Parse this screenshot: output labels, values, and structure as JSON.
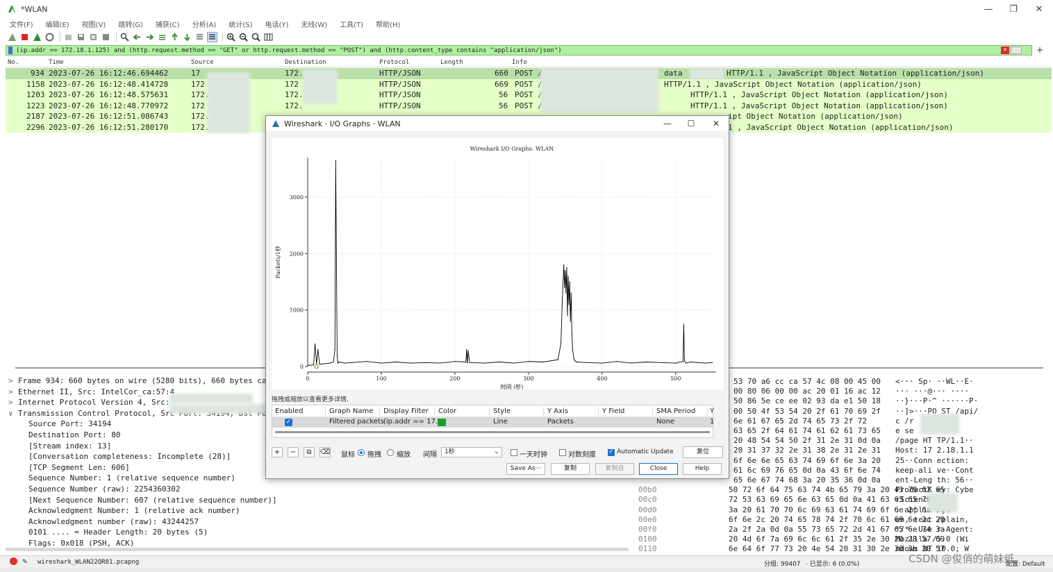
{
  "window": {
    "title": "*WLAN",
    "min": "—",
    "max": "❐",
    "close": "✕"
  },
  "menu": [
    "文件(F)",
    "编辑(E)",
    "视图(V)",
    "跳转(G)",
    "捕获(C)",
    "分析(A)",
    "统计(S)",
    "电话(Y)",
    "无线(W)",
    "工具(T)",
    "帮助(H)"
  ],
  "toolbar": [
    "shark-fin-start-icon",
    "stop-capture-icon",
    "restart-capture-icon",
    "capture-options-icon",
    "open-file-icon",
    "save-file-icon",
    "close-file-icon",
    "reload-file-icon",
    "find-packet-icon",
    "go-back-icon",
    "go-forward-icon",
    "go-to-packet-icon",
    "go-first-icon",
    "go-last-icon",
    "autoscroll-icon",
    "colorize-icon",
    "zoom-in-icon",
    "zoom-out-icon",
    "normal-size-icon",
    "resize-columns-icon"
  ],
  "filter": {
    "text": "(ip.addr == 172.18.1.125) and (http.request.method == \"GET\" or http.request.method == \"POST\") and (http.content_type contains \"application/json\")",
    "clear": "✕",
    "add": "+"
  },
  "packet_list": {
    "columns": [
      "No.",
      "Time",
      "Source",
      "Destination",
      "Protocol",
      "Length",
      "Info"
    ],
    "rows": [
      {
        "no": "934",
        "time": "2023-07-26 16:12:46.694462",
        "src": "17",
        "dst": "172.",
        "proto": "HTTP/JSON",
        "len": "660",
        "info": "POST /a",
        "info2": "data",
        "info3": "HTTP/1.1 , JavaScript Object Notation (application/json)"
      },
      {
        "no": "1158",
        "time": "2023-07-26 16:12:48.414728",
        "src": "172",
        "dst": "172",
        "proto": "HTTP/JSON",
        "len": "669",
        "info": "POST /api/u",
        "info2": "",
        "info3": "HTTP/1.1 , JavaScript Object Notation (application/json)"
      },
      {
        "no": "1203",
        "time": "2023-07-26 16:12:48.575631",
        "src": "172.",
        "dst": "172.",
        "proto": "HTTP/JSON",
        "len": "56",
        "info": "POST /api/u",
        "info2": "",
        "info3": "HTTP/1.1 , JavaScript Object Notation (application/json)"
      },
      {
        "no": "1223",
        "time": "2023-07-26 16:12:48.770972",
        "src": "172",
        "dst": "172.",
        "proto": "HTTP/JSON",
        "len": "56",
        "info": "POST /api/us",
        "info2": "",
        "info3": "HTTP/1.1 , JavaScript Object Notation (application/json)"
      },
      {
        "no": "2187",
        "time": "2023-07-26 16:12:51.086743",
        "src": "172.",
        "dst": "",
        "proto": "",
        "len": "",
        "info": "",
        "info2": "",
        "info3": "ipt Object Notation (application/json)"
      },
      {
        "no": "2296",
        "time": "2023-07-26 16:12:51.280170",
        "src": "172.",
        "dst": "",
        "proto": "",
        "len": "",
        "info": "",
        "info2": "",
        "info3": "1 , JavaScript Object Notation (application/json)"
      }
    ]
  },
  "details": [
    {
      "arrow": ">",
      "text": "Frame 934: 660 bytes on wire (5280 bits), 660 bytes cap"
    },
    {
      "arrow": ">",
      "text": "Ethernet II, Src: IntelCor_ca:57:4"
    },
    {
      "arrow": ">",
      "text": "Internet Protocol Version 4, Src:"
    },
    {
      "arrow": "∨",
      "text": "Transmission Control Protocol, Src Port: 34194, Dst Por"
    },
    {
      "arrow": "",
      "text": "Source Port: 34194"
    },
    {
      "arrow": "",
      "text": "Destination Port: 80"
    },
    {
      "arrow": "",
      "text": "[Stream index: 13]"
    },
    {
      "arrow": "",
      "text": "[Conversation completeness: Incomplete (28)]"
    },
    {
      "arrow": "",
      "text": "[TCP Segment Len: 606]"
    },
    {
      "arrow": "",
      "text": "Sequence Number: 1    (relative sequence number)"
    },
    {
      "arrow": "",
      "text": "Sequence Number (raw): 2254360302"
    },
    {
      "arrow": "",
      "text": "[Next Sequence Number: 607    (relative sequence number)]"
    },
    {
      "arrow": "",
      "text": "Acknowledgment Number: 1    (relative ack number)"
    },
    {
      "arrow": "",
      "text": "Acknowledgment number (raw): 43244257"
    },
    {
      "arrow": "",
      "text": "0101 .... = Header Length: 20 bytes (5)"
    },
    {
      "arrow": "",
      "text": "Flags: 0x018 (PSH, ACK)"
    }
  ],
  "bytes": [
    {
      "off": "",
      "hex": "53 70 a6   cc ca 57 4c 08 00 45 00",
      "asc": "<··· Sp· ··WL··E·"
    },
    {
      "off": "",
      "hex": "00 80 06   00 00 ac 20 01 16 ac 12",
      "asc": "··· ···@··· ····"
    },
    {
      "off": "",
      "hex": "50 86 5e   ce ee 02 93 da e1 50 18",
      "asc": "··}···P·^ ······P·"
    },
    {
      "off": "",
      "hex": "00 50 4f   53 54 20 2f 61 70 69 2f",
      "asc": "··]>···PO ST /api/"
    },
    {
      "off": "",
      "hex": "6e 61 67   65 2d 74 65 73 2f 72",
      "asc": "c          /r"
    },
    {
      "off": "",
      "hex": "63 65 2f   64 61 74 61 62 61 73 65",
      "asc": "e          se"
    },
    {
      "off": "",
      "hex": "20 48 54   54 50 2f 31 2e 31 0d 0a",
      "asc": "/page HT TP/1.1··"
    },
    {
      "off": "",
      "hex": "20 31 37   32 2e 31 38 2e 31 2e 31",
      "asc": "Host: 17 2.18.1.1"
    },
    {
      "off": "",
      "hex": "6f 6e 6e   65 63 74 69 6f 6e 3a 20",
      "asc": "25··Conn ection:"
    },
    {
      "off": "",
      "hex": "61 6c 69   76 65 0d 0a 43 6f 6e 74",
      "asc": "keep-ali ve··Cont"
    },
    {
      "off": "",
      "hex": "65 6e 67   74 68 3a 20 35 36 0d 0a",
      "asc": "ent-Leng th: 56··"
    },
    {
      "off": "00b0",
      "hex": "50 72 6f 64 75 63 74 4b   65 79 3a 20 43 79 62 65",
      "asc": "ProductK ey: Cybe"
    },
    {
      "off": "00c0",
      "hex": "72 53 63 69 65 6e 63 65   0d 0a 41 63 63 65 70 74",
      "asc": "rScience       t"
    },
    {
      "off": "00d0",
      "hex": "3a 20 61 70 70 6c 69 63   61 74 69 6f 6e 2f 6a 73",
      "asc": ": applic      /js"
    },
    {
      "off": "00e0",
      "hex": "6f 6e 2c 20 74 65 78 74   2f 70 6c 61 69 6e 2c 20",
      "asc": "on, text /plain,"
    },
    {
      "off": "00f0",
      "hex": "2a 2f 2a 0d 0a 55 73 65   72 2d 41 67 65 6e 74 3a",
      "asc": "*/*··Use r-Agent:"
    },
    {
      "off": "0100",
      "hex": "20 4d 6f 7a 69 6c 6c 61   2f 35 2e 30 20 28 57 69",
      "asc": " Mozilla /5.0 (Wi"
    },
    {
      "off": "0110",
      "hex": "6e 64 6f 77 73 20 4e 54   20 31 30 2e 30 3b 20 57",
      "asc": "ndows NT  10.0; W"
    }
  ],
  "status": {
    "file": "wireshark_WLAN22QR81.pcapng",
    "packets": "分组: 99407",
    "displayed": "· 已显示: 6 (0.0%)",
    "profile": "配置: Default"
  },
  "io_dialog": {
    "title": "Wireshark · I/O Graphs · WLAN",
    "min": "—",
    "max": "☐",
    "close": "✕",
    "hint": "拖拽或缩放以查看更多详情.",
    "table": {
      "headers": [
        "Enabled",
        "Graph Name",
        "Display Filter",
        "Color",
        "Style",
        "Y Axis",
        "Y Field",
        "SMA Period",
        "Y"
      ],
      "row": {
        "enabled": "✓",
        "name": "Filtered packets",
        "filter": "(ip.addr == 17...",
        "style": "Line",
        "yaxis": "Packets",
        "yfield": "",
        "sma": "None",
        "extra": "1"
      }
    },
    "controls": {
      "add": "+",
      "remove": "−",
      "copy_graph": "⧉",
      "clear": "⌫",
      "mouse_label": "鼠标",
      "drag": "拖拽",
      "zoom": "缩放",
      "interval_label": "间隔",
      "interval": "1秒",
      "time_of_day": "一天时钟",
      "log_scale": "对数刻度",
      "auto_update": "Automatic Update",
      "reset": "复位"
    },
    "buttons": {
      "save_as": "Save As···",
      "copy": "复制",
      "copy_from": "复制自",
      "close": "Close",
      "help": "Help"
    }
  },
  "chart_data": {
    "type": "line",
    "title": "Wireshark I/O Graphs: WLAN",
    "xlabel": "时间 (秒)",
    "ylabel": "Packets/1秒",
    "xlim": [
      0,
      555
    ],
    "ylim": [
      0,
      3700
    ],
    "xticks": [
      0,
      100,
      200,
      300,
      400,
      500
    ],
    "yticks": [
      0,
      1000,
      2000,
      3000
    ],
    "grid": true,
    "series": [
      {
        "color": "#000000",
        "x": [
          0,
          8,
          10,
          12,
          14,
          16,
          30,
          35,
          37,
          38,
          39,
          40,
          41,
          43,
          50,
          60,
          80,
          100,
          120,
          140,
          160,
          180,
          200,
          215,
          216,
          217,
          218,
          220,
          240,
          260,
          280,
          300,
          320,
          340,
          344,
          346,
          348,
          349,
          350,
          351,
          352,
          353,
          354,
          355,
          356,
          357,
          358,
          359,
          360,
          362,
          365,
          380,
          400,
          420,
          440,
          460,
          480,
          500,
          510,
          511,
          512,
          513,
          514,
          520,
          540,
          550
        ],
        "y": [
          20,
          30,
          400,
          50,
          300,
          40,
          60,
          80,
          300,
          3650,
          2000,
          200,
          60,
          80,
          60,
          70,
          90,
          60,
          80,
          60,
          70,
          60,
          90,
          80,
          300,
          60,
          280,
          70,
          60,
          80,
          60,
          90,
          80,
          120,
          400,
          1200,
          1800,
          1400,
          1700,
          1300,
          1750,
          900,
          1600,
          1100,
          1500,
          800,
          1300,
          600,
          300,
          120,
          80,
          70,
          60,
          90,
          60,
          80,
          70,
          60,
          90,
          750,
          100,
          80,
          60,
          80,
          60,
          70
        ]
      }
    ]
  },
  "watermark": "CSDN @俊俏的萌妹纸."
}
